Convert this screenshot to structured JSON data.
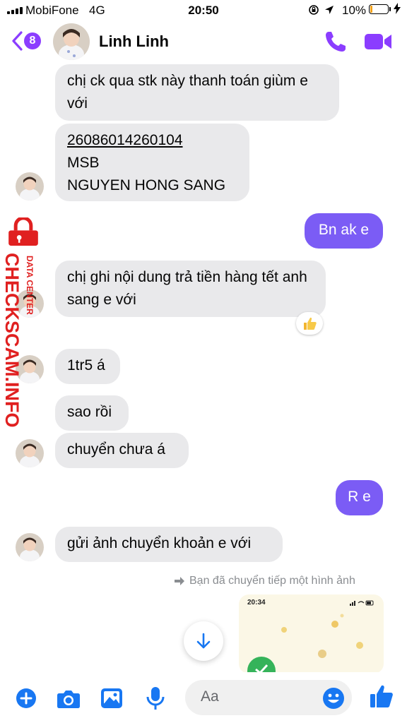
{
  "status_bar": {
    "carrier": "MobiFone",
    "network": "4G",
    "time": "20:50",
    "battery_percent": "10%"
  },
  "header": {
    "unread_count": "8",
    "contact_name": "Linh Linh"
  },
  "messages": [
    {
      "direction": "in",
      "text": "chị ck qua stk này thanh toán giùm e với"
    },
    {
      "direction": "in",
      "lines": [
        "26086014260104",
        "MSB",
        "NGUYEN HONG SANG"
      ]
    },
    {
      "direction": "out",
      "text": "Bn ak e"
    },
    {
      "direction": "in",
      "text": "chị ghi nội dung trả tiền hàng tết anh sang e với",
      "reaction": "thumbs-up"
    },
    {
      "direction": "in",
      "text": "1tr5 á"
    },
    {
      "direction": "in",
      "text": "sao rồi"
    },
    {
      "direction": "in",
      "text": "chuyển chưa á"
    },
    {
      "direction": "out",
      "text": "R e"
    },
    {
      "direction": "in",
      "text": "gửi ảnh chuyển khoản e với"
    }
  ],
  "forward_note": "Bạn đã chuyển tiếp một hình ảnh",
  "image_preview": {
    "time": "20:34"
  },
  "composer": {
    "placeholder": "Aa"
  },
  "watermark": {
    "brand": "CHECKSCAM.INFO",
    "tag": "DATA CENTER"
  },
  "colors": {
    "accent": "#8b3dff",
    "outgoing_bubble": "#7b5cf5",
    "incoming_bubble": "#e9e9eb",
    "composer_icons": "#1877f2",
    "watermark": "#e02020"
  }
}
